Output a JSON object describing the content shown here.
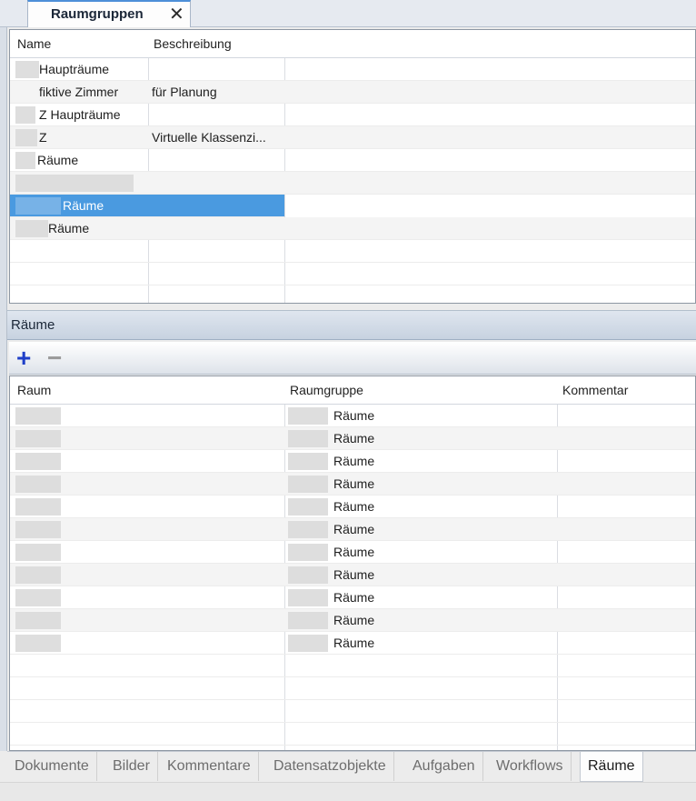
{
  "tab": {
    "title": "Raumgruppen",
    "close_glyph": "✕"
  },
  "raumgruppen": {
    "columns": {
      "name": "Name",
      "beschreibung": "Beschreibung"
    },
    "rows": [
      {
        "name": "Haupträume",
        "beschreibung": ""
      },
      {
        "name": "fiktive Zimmer",
        "beschreibung": "für Planung"
      },
      {
        "name": "Z Haupträume",
        "beschreibung": ""
      },
      {
        "name": "Z",
        "beschreibung": "Virtuelle Klassenzi..."
      },
      {
        "name": "Räume",
        "beschreibung": ""
      },
      {
        "name": "",
        "beschreibung": ""
      },
      {
        "name": "Räume",
        "beschreibung": ""
      },
      {
        "name": "Räume",
        "beschreibung": ""
      }
    ],
    "selected_index": 6
  },
  "raeume": {
    "section_title": "Räume",
    "toolbar": {
      "add_glyph": "+",
      "remove_glyph": "−"
    },
    "columns": {
      "raum": "Raum",
      "raumgruppe": "Raumgruppe",
      "kommentar": "Kommentar"
    },
    "rows": [
      {
        "raum": "",
        "raumgruppe": "Räume",
        "kommentar": ""
      },
      {
        "raum": "",
        "raumgruppe": "Räume",
        "kommentar": ""
      },
      {
        "raum": "",
        "raumgruppe": "Räume",
        "kommentar": ""
      },
      {
        "raum": "",
        "raumgruppe": "Räume",
        "kommentar": ""
      },
      {
        "raum": "",
        "raumgruppe": "Räume",
        "kommentar": ""
      },
      {
        "raum": "",
        "raumgruppe": "Räume",
        "kommentar": ""
      },
      {
        "raum": "",
        "raumgruppe": "Räume",
        "kommentar": ""
      },
      {
        "raum": "",
        "raumgruppe": "Räume",
        "kommentar": ""
      },
      {
        "raum": "",
        "raumgruppe": "Räume",
        "kommentar": ""
      },
      {
        "raum": "",
        "raumgruppe": "Räume",
        "kommentar": ""
      },
      {
        "raum": "",
        "raumgruppe": "Räume",
        "kommentar": ""
      }
    ]
  },
  "bottom_tabs": [
    "Dokumente",
    "Bilder",
    "Kommentare",
    "Datensatzobjekte",
    "Aufgaben",
    "Workflows",
    "Räume"
  ],
  "bottom_tabs_active": 6,
  "colors": {
    "selection": "#4a9ae0",
    "add_icon": "#1f3fc8",
    "tab_accent": "#4d8fd8"
  }
}
